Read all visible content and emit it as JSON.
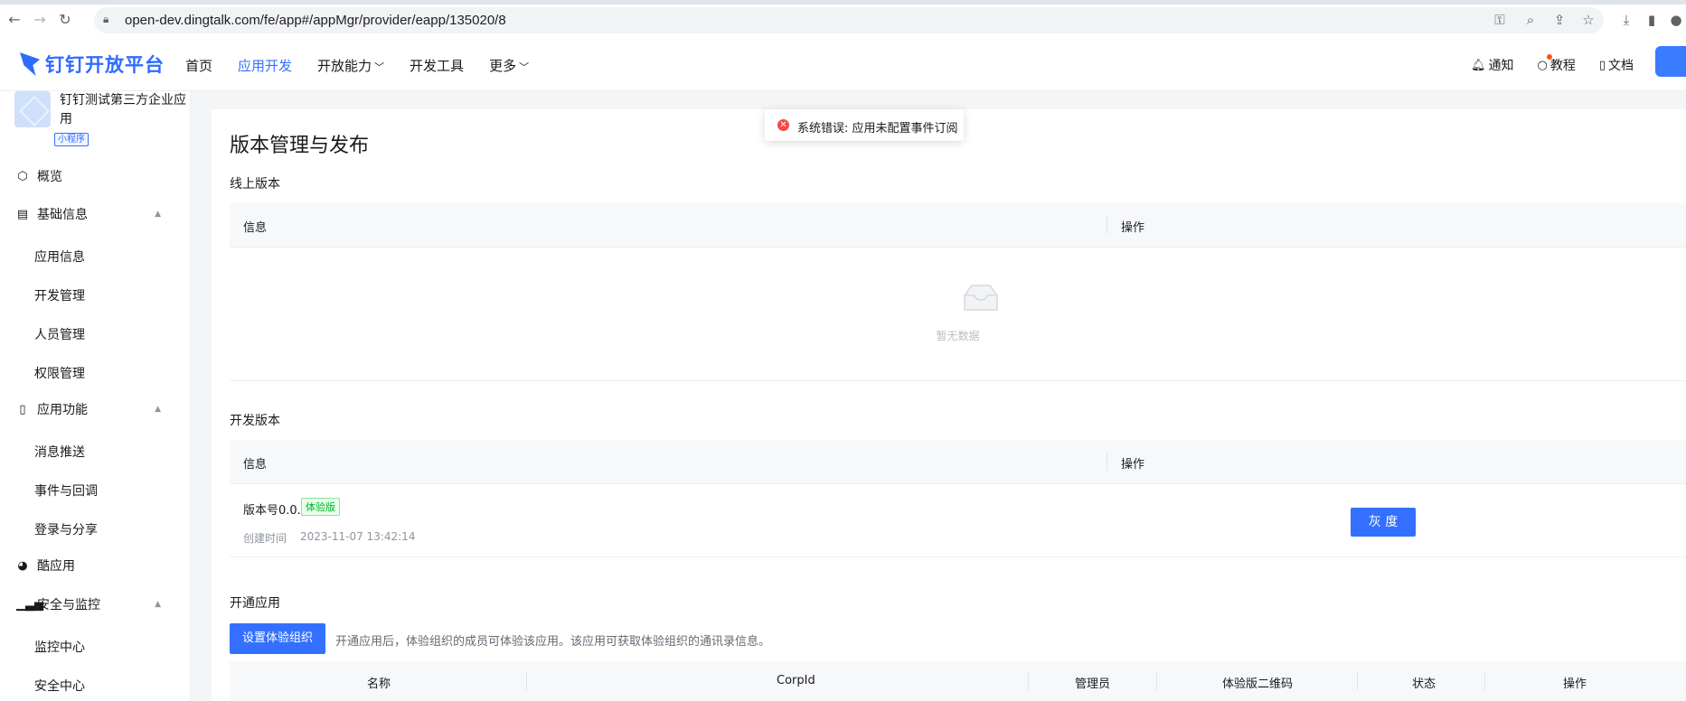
{
  "browser": {
    "url": "open-dev.dingtalk.com/fe/app#/appMgr/provider/eapp/135020/8",
    "icons": [
      "back-icon",
      "forward-icon",
      "reload-icon",
      "lock-icon",
      "key-icon",
      "zoom-icon",
      "share-icon",
      "star-icon",
      "download-icon",
      "sidepanel-icon",
      "profile-icon"
    ]
  },
  "header": {
    "logo_text": "钉钉开放平台",
    "menu": [
      {
        "label": "首页"
      },
      {
        "label": "应用开发"
      },
      {
        "label": "开放能力"
      },
      {
        "label": "开发工具"
      },
      {
        "label": "更多"
      }
    ],
    "right": {
      "notify": "通知",
      "tutorial": "教程",
      "docs": "文档"
    }
  },
  "sidebar": {
    "app_name": "钉钉测试第三方企业应用",
    "app_badge": "小程序",
    "overview": "概览",
    "groups": [
      {
        "label": "基础信息",
        "items": [
          "应用信息",
          "开发管理",
          "人员管理",
          "权限管理"
        ]
      },
      {
        "label": "应用功能",
        "items": [
          "消息推送",
          "事件与回调",
          "登录与分享"
        ]
      },
      {
        "label": "酷应用",
        "items": []
      },
      {
        "label": "安全与监控",
        "items": [
          "监控中心",
          "安全中心"
        ]
      }
    ]
  },
  "main": {
    "title": "版本管理与发布",
    "online": {
      "title": "线上版本",
      "col_info": "信息",
      "col_action": "操作",
      "empty_text": "暂无数据"
    },
    "dev": {
      "title": "开发版本",
      "col_info": "信息",
      "col_action": "操作",
      "version_label": "版本号0.0.1",
      "tag": "体验版",
      "created_label": "创建时间",
      "created_time": "2023-11-07 13:42:14",
      "gray_button": "灰 度"
    },
    "open": {
      "title": "开通应用",
      "button": "设置体验组织",
      "hint": "开通应用后，体验组织的成员可体验该应用。该应用可获取体验组织的通讯录信息。",
      "columns": [
        "名称",
        "CorpId",
        "管理员",
        "体验版二维码",
        "状态",
        "操作"
      ]
    }
  },
  "toast": {
    "message": "系统错误: 应用未配置事件订阅"
  }
}
